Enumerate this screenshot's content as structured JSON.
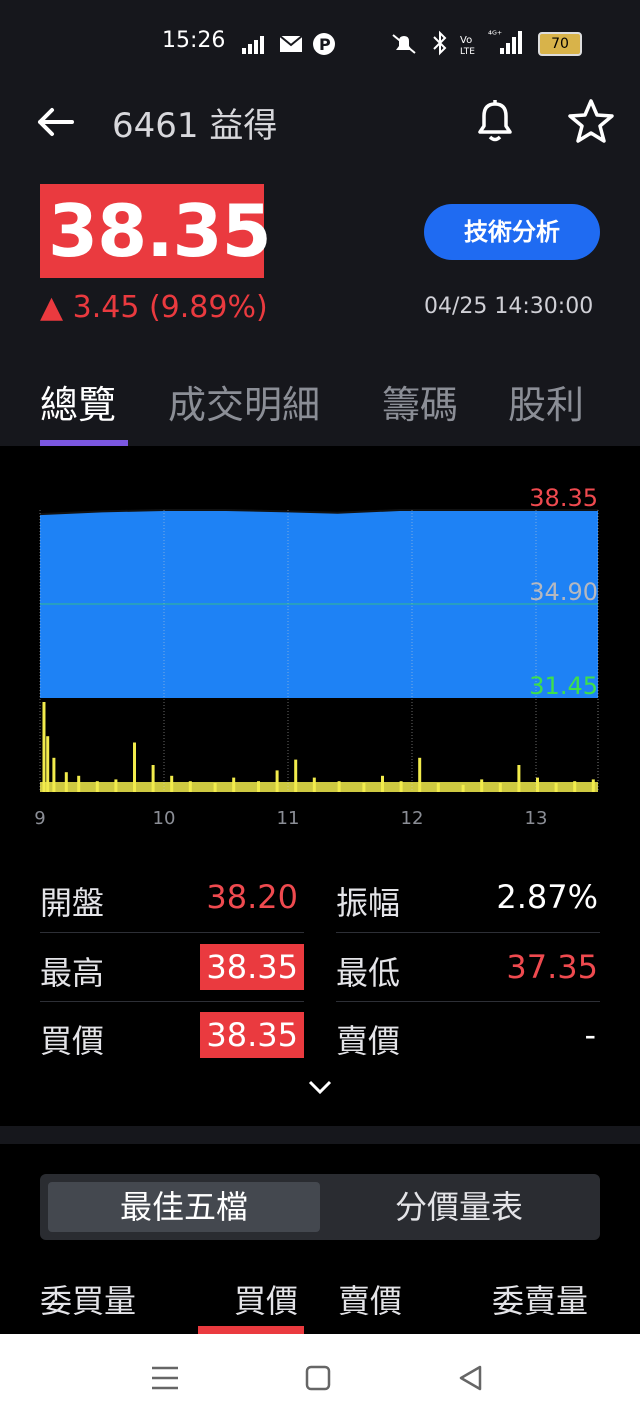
{
  "status_bar": {
    "time": "15:26",
    "battery": "70",
    "icons": [
      "signal-icon",
      "mail-icon",
      "parking-icon",
      "mute-icon",
      "bluetooth-icon",
      "volte-icon",
      "4g-signal-icon",
      "battery-icon"
    ]
  },
  "header": {
    "title": "6461 益得"
  },
  "quote": {
    "price": "38.35",
    "change": "▲ 3.45 (9.89%)",
    "timestamp": "04/25 14:30:00",
    "tech_button": "技術分析"
  },
  "tabs": [
    {
      "label": "總覽"
    },
    {
      "label": "成交明細"
    },
    {
      "label": "籌碼"
    },
    {
      "label": "股利"
    }
  ],
  "chart_data": {
    "type": "area",
    "x_tick_labels": [
      "9",
      "10",
      "11",
      "12",
      "13"
    ],
    "y_tick_labels": [
      "38.35",
      "34.90",
      "31.45"
    ],
    "ylim": [
      31.45,
      38.35
    ],
    "price_series": {
      "x": [
        9.0,
        9.5,
        10.0,
        10.5,
        11.0,
        11.4,
        11.9,
        12.5,
        13.0,
        13.5
      ],
      "y": [
        38.2,
        38.3,
        38.35,
        38.35,
        38.3,
        38.25,
        38.35,
        38.35,
        38.35,
        38.35
      ]
    },
    "volume_series": {
      "x": [
        9.02,
        9.05,
        9.1,
        9.2,
        9.3,
        9.45,
        9.6,
        9.75,
        9.9,
        10.05,
        10.2,
        10.4,
        10.55,
        10.75,
        10.9,
        11.05,
        11.2,
        11.4,
        11.6,
        11.75,
        11.9,
        12.05,
        12.2,
        12.4,
        12.55,
        12.7,
        12.85,
        13.0,
        13.15,
        13.3,
        13.45
      ],
      "v": [
        100,
        62,
        38,
        22,
        18,
        12,
        14,
        55,
        30,
        18,
        12,
        10,
        16,
        12,
        24,
        36,
        16,
        12,
        10,
        18,
        12,
        38,
        10,
        8,
        14,
        10,
        30,
        16,
        10,
        12,
        14
      ]
    },
    "colors": {
      "area": "#1e82f5",
      "volume": "#f2ec4c",
      "max_label": "#ef4a4f",
      "mid_label": "#b5b8c0",
      "min_label": "#3fe04a"
    }
  },
  "stats": {
    "open_label": "開盤",
    "open_value": "38.20",
    "amplitude_label": "振幅",
    "amplitude_value": "2.87%",
    "high_label": "最高",
    "high_value": "38.35",
    "low_label": "最低",
    "low_value": "37.35",
    "bid_label": "買價",
    "bid_value": "38.35",
    "ask_label": "賣價",
    "ask_value": "-"
  },
  "order_book": {
    "seg_best5": "最佳五檔",
    "seg_price_volume": "分價量表",
    "col_bid_vol": "委買量",
    "col_bid_price": "買價",
    "col_ask_price": "賣價",
    "col_ask_vol": "委賣量"
  }
}
